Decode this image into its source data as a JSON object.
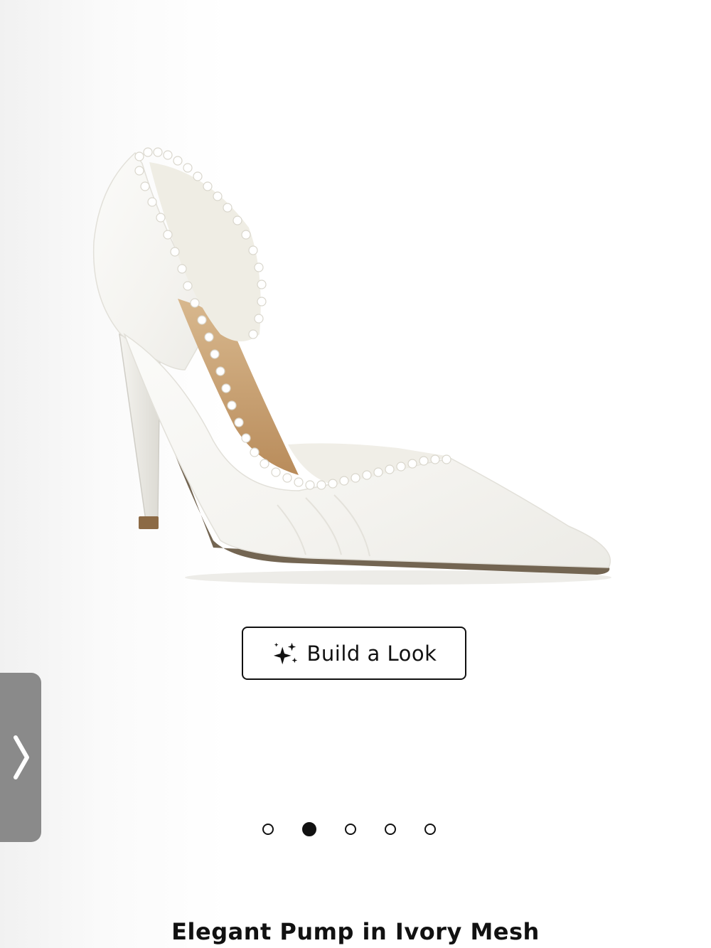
{
  "product": {
    "title": "Elegant Pump in Ivory Mesh",
    "image": "white-pearl-trim-dorsay-pump"
  },
  "build_look": {
    "label": "Build a Look",
    "icon": "sparkle-icon"
  },
  "side_tab": {
    "icon": "chevron-right-icon"
  },
  "carousel": {
    "total": 5,
    "active_index": 1
  },
  "colors": {
    "accent": "#111111",
    "tab": "#8a8a8a"
  }
}
